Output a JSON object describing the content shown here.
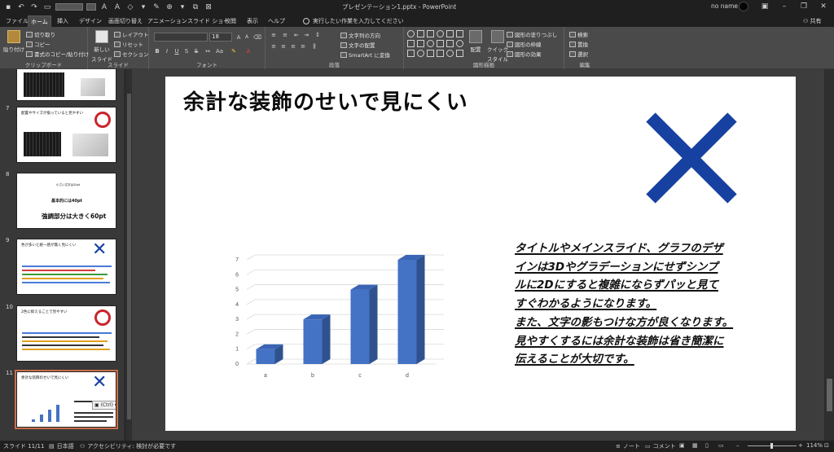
{
  "window": {
    "title": "プレゼンテーション1.pptx  -  PowerPoint",
    "user_name": "no name",
    "controls": [
      "–",
      "❐",
      "✕"
    ]
  },
  "tabs": [
    "ファイル",
    "ホーム",
    "挿入",
    "デザイン",
    "画面切り替え",
    "アニメーション",
    "スライド ショー",
    "校閲",
    "表示",
    "ヘルプ"
  ],
  "active_tab": "ホーム",
  "tell_me": "実行したい作業を入力してください",
  "share": "共有",
  "ribbon": {
    "clipboard": {
      "label": "クリップボード",
      "paste": "貼り付け",
      "cut": "切り取り",
      "copy": "コピー",
      "format_painter": "書式のコピー/貼り付け"
    },
    "slides": {
      "label": "スライド",
      "new_slide": "新しい",
      "new_slide2": "スライド",
      "layout": "レイアウト",
      "reset": "リセット",
      "section": "セクション"
    },
    "font": {
      "label": "フォント",
      "size": "18",
      "bold": "B",
      "italic": "I",
      "underline": "U",
      "strike": "S",
      "grow": "A",
      "shrink": "A"
    },
    "paragraph": {
      "label": "段落",
      "text_direction": "文字列の方向",
      "align_text": "文字の配置",
      "smartart": "SmartArt に変換"
    },
    "drawing": {
      "label": "図形描画",
      "arrange": "配置",
      "quick_styles": "クイック",
      "quick_styles2": "スタイル",
      "shape_fill": "図形の塗りつぶし",
      "shape_outline": "図形の枠線",
      "shape_effects": "図形の効果"
    },
    "editing": {
      "label": "編集",
      "find": "検索",
      "replace": "置換",
      "select": "選択"
    }
  },
  "thumbnails": [
    {
      "number": "7",
      "title": "配置やサイズが揃っていると見やすい"
    },
    {
      "number": "8",
      "line1": "小さい文字は20pt",
      "line2": "基本的には40pt",
      "line3": "強調部分は大きく60pt"
    },
    {
      "number": "9",
      "title": "色が多いと統一感が無く見にくい"
    },
    {
      "number": "10",
      "title": "2色に抑えることで見やすい"
    },
    {
      "number": "11",
      "title": "余計な装飾のせいで見にくい",
      "ctrl_chip": "(Ctrl)"
    }
  ],
  "slide": {
    "title": "余計な装飾のせいで見にくい",
    "body_lines": [
      "タイトルやメインスライド、グラフのデザ",
      "インは3Dやグラデーションにせずシンプ",
      "ルに2Dにすると複雑にならずパッと見て",
      "すぐわかるようになります。",
      "また、文字の影もつけな方が良くなります。",
      "見やすくするには余計な装飾は省き簡潔に",
      "伝えることが大切です。"
    ],
    "x_color": "#1741a0"
  },
  "chart_data": {
    "type": "bar",
    "style": "3d-column",
    "categories": [
      "a",
      "b",
      "c",
      "d"
    ],
    "values": [
      1,
      3,
      5,
      7
    ],
    "ylim": [
      0,
      7
    ],
    "yticks": [
      "0",
      "1",
      "2",
      "3",
      "4",
      "5",
      "6",
      "7"
    ],
    "title": "",
    "xlabel": "",
    "ylabel": "",
    "grid": true,
    "colors": {
      "front": "#4472c4",
      "side": "#2f528f",
      "top": "#3a64b4"
    }
  },
  "status": {
    "slide_info": "スライド 11/11",
    "language": "日本語",
    "accessibility": "アクセシビリティ: 検討が必要です",
    "notes": "ノート",
    "comments": "コメント",
    "zoom": "114%"
  }
}
